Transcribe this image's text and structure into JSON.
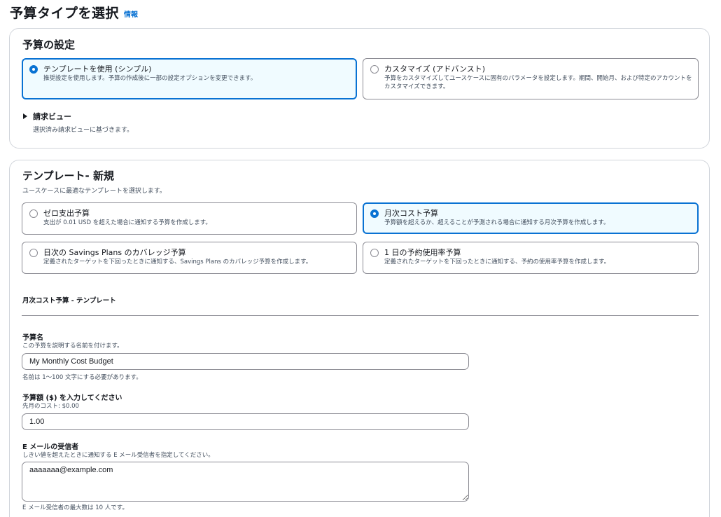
{
  "header": {
    "title": "予算タイプを選択",
    "info_link": "情報"
  },
  "budget_settings": {
    "heading": "予算の設定",
    "options": [
      {
        "title": "テンプレートを使用 (シンプル)",
        "description": "推奨設定を使用します。予算の作成後に一部の設定オプションを変更できます。",
        "selected": true
      },
      {
        "title": "カスタマイズ (アドバンスト)",
        "description": "予算をカスタマイズしてユースケースに固有のパラメータを設定します。期間、開始月、および特定のアカウントをカスタマイズできます。",
        "selected": false
      }
    ],
    "billing_view": {
      "label": "請求ビュー",
      "description": "選択済み請求ビューに基づきます。"
    }
  },
  "templates": {
    "heading": "テンプレート- 新規",
    "description": "ユースケースに最適なテンプレートを選択します。",
    "options": [
      {
        "title": "ゼロ支出予算",
        "description": "支出が 0.01 USD を超えた場合に通知する予算を作成します。",
        "selected": false
      },
      {
        "title": "月次コスト予算",
        "description": "予算額を超えるか、超えることが予測される場合に通知する月次予算を作成します。",
        "selected": true
      },
      {
        "title": "日次の Savings Plans のカバレッジ予算",
        "description": "定義されたターゲットを下回ったときに通知する、Savings Plans のカバレッジ予算を作成します。",
        "selected": false
      },
      {
        "title": "1 日の予約使用率予算",
        "description": "定義されたターゲットを下回ったときに通知する、予約の使用率予算を作成します。",
        "selected": false
      }
    ],
    "section_title": "月次コスト予算 - テンプレート",
    "fields": {
      "budget_name": {
        "label": "予算名",
        "description": "この予算を説明する名前を付けます。",
        "value": "My Monthly Cost Budget",
        "hint": "名前は 1～100 文字にする必要があります。"
      },
      "budget_amount": {
        "label": "予算額 ($) を入力してください",
        "description": "先月のコスト: $0.00",
        "value": "1.00"
      },
      "email_recipients": {
        "label": "E メールの受信者",
        "description": "しきい値を超えたときに通知する E メール受信者を指定してください。",
        "value": "aaaaaaa@example.com",
        "hint": "E メール受信者の最大数は 10 人です。"
      }
    }
  },
  "colors": {
    "accent": "#0972d3",
    "selected_bg": "#f0fbff",
    "border": "#8c8c94",
    "text": "#16191f",
    "muted": "#414d5c"
  }
}
